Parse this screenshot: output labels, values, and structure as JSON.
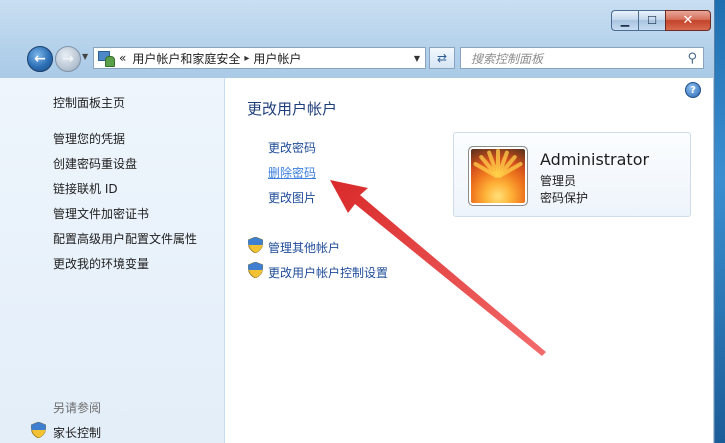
{
  "window": {
    "caption": {
      "minimize": "▁",
      "maximize": "☐",
      "close": "✕"
    }
  },
  "nav": {
    "back_icon": "back-arrow-icon",
    "forward_icon": "forward-arrow-icon",
    "address": {
      "prefix": "«",
      "crumb1": "用户帐户和家庭安全",
      "sep": "▸",
      "crumb2": "用户帐户"
    },
    "search_placeholder": "搜索控制面板"
  },
  "sidebar": {
    "home": "控制面板主页",
    "links": [
      "管理您的凭据",
      "创建密码重设盘",
      "链接联机 ID",
      "管理文件加密证书",
      "配置高级用户配置文件属性",
      "更改我的环境变量"
    ],
    "see_also": "另请参阅",
    "parental": "家长控制"
  },
  "main": {
    "help": "?",
    "title": "更改用户帐户",
    "tasks": [
      "更改密码",
      "删除密码",
      "更改图片"
    ],
    "admin_tasks": [
      "管理其他帐户",
      "更改用户帐户控制设置"
    ],
    "account": {
      "name": "Administrator",
      "role": "管理员",
      "status": "密码保护"
    }
  },
  "colors": {
    "link": "#1f4c99",
    "link_hover": "#3c7fdc",
    "arrow": "#e03a3a",
    "title": "#1f3f7a"
  }
}
